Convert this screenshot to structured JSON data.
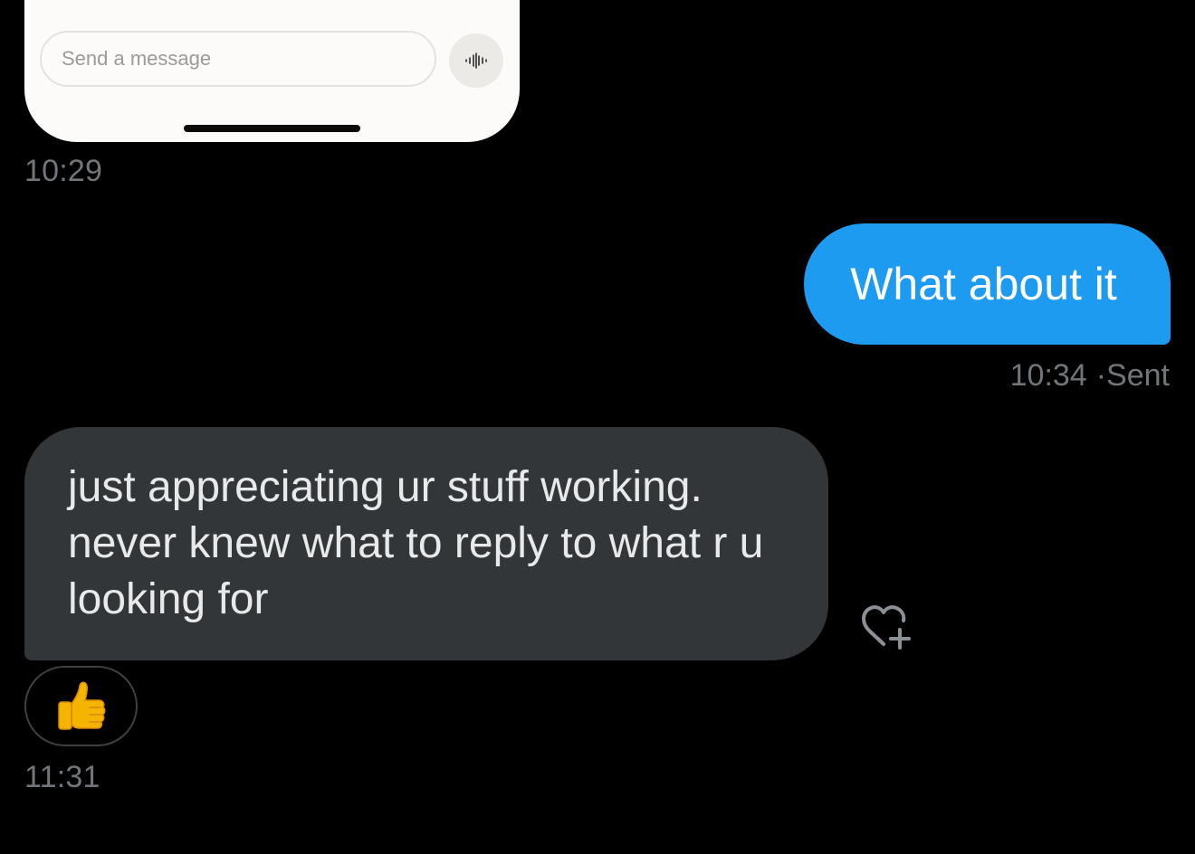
{
  "embedded_screenshot": {
    "input_placeholder": "Send a message",
    "voice_icon": "waveform-icon"
  },
  "messages": [
    {
      "direction": "outgoing",
      "text": "What about it",
      "time": "10:34",
      "status_separator": "·",
      "status": "Sent"
    },
    {
      "direction": "incoming",
      "text": "just appreciating ur stuff working. never knew what to reply to what r u looking for",
      "reaction_emoji": "👍",
      "time": "11:31"
    }
  ],
  "first_timestamp": "10:29",
  "icons": {
    "add_reaction": "heart-plus-icon"
  },
  "colors": {
    "background": "#000000",
    "outgoing_bubble": "#1d9bf0",
    "incoming_bubble": "#323639",
    "timestamp": "#71767b"
  }
}
